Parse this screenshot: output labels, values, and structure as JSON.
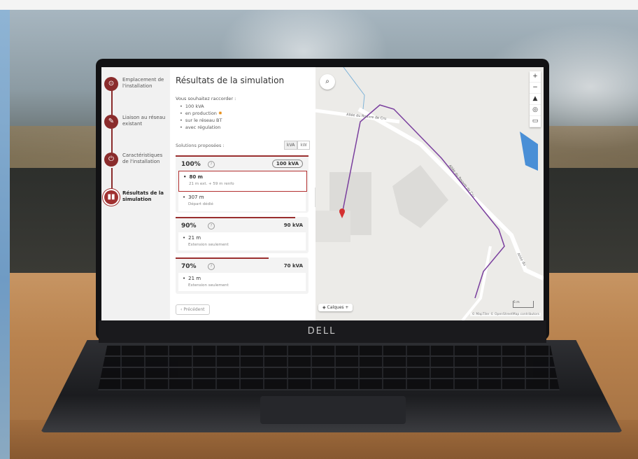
{
  "device": {
    "brand": "DELL"
  },
  "stepper": {
    "steps": [
      {
        "label": "Emplacement de l'installation",
        "icon": "location-pin-icon"
      },
      {
        "label": "Liaison au réseau existant",
        "icon": "pencil-icon"
      },
      {
        "label": "Caractéristiques de l'installation",
        "icon": "plug-icon"
      },
      {
        "label": "Résultats de la simulation",
        "icon": "bar-chart-icon",
        "active": true
      }
    ]
  },
  "results": {
    "title": "Résultats de la simulation",
    "intro": "Vous souhaitez raccorder :",
    "bullets": [
      "100 kVA",
      "en production",
      "sur le réseau BT",
      "avec régulation"
    ],
    "solutions_label": "Solutions proposées :",
    "units": [
      "kVA",
      "kW"
    ],
    "cards": [
      {
        "percent": "100%",
        "power": "100 kVA",
        "level": 1.0,
        "options": [
          {
            "distance": "80 m",
            "detail": "21 m ext. + 59 m renfo",
            "selected": true
          },
          {
            "distance": "307 m",
            "detail": "Départ dédié",
            "selected": false
          }
        ]
      },
      {
        "percent": "90%",
        "power": "90 kVA",
        "level": 0.9,
        "options": [
          {
            "distance": "21 m",
            "detail": "Extension seulement",
            "selected": false
          }
        ]
      },
      {
        "percent": "70%",
        "power": "70 kVA",
        "level": 0.7,
        "options": [
          {
            "distance": "21 m",
            "detail": "Extension seulement",
            "selected": false
          }
        ]
      }
    ],
    "previous_label": "Précédent",
    "collapse_glyph": "‹"
  },
  "map": {
    "road_labels": [
      "Allée du Rouvre de Cru",
      "Allée du Rouvre de Cru",
      "Allée du"
    ],
    "layers_label": "Calques",
    "scale_label": "5 m",
    "attribution": "© MapTiler © OpenStreetMap contributors",
    "controls": [
      "+",
      "−",
      "▲",
      "◎",
      "▭"
    ]
  },
  "colors": {
    "accent": "#8a2c2c",
    "route": "#7a3f9e"
  }
}
